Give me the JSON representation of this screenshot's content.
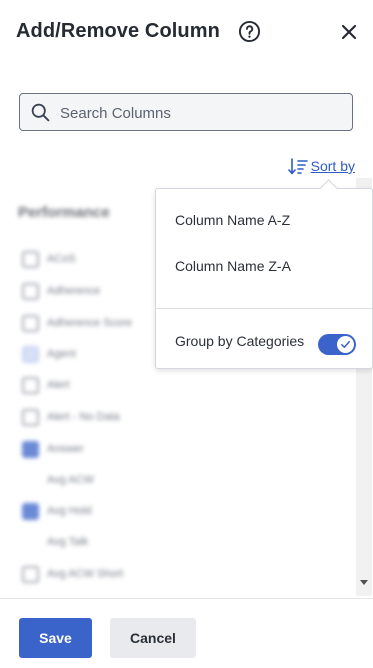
{
  "header": {
    "title": "Add/Remove Column"
  },
  "icons": {
    "help": "question-circle-icon",
    "close": "close-x-icon",
    "search": "magnifier-icon",
    "sort": "sort-descending-icon",
    "check": "check-icon"
  },
  "search": {
    "placeholder": "Search Columns",
    "value": ""
  },
  "sort": {
    "label": "Sort by"
  },
  "sort_menu": {
    "options": [
      "Column Name A-Z",
      "Column Name Z-A"
    ],
    "group_label": "Group by Categories",
    "group_enabled": true
  },
  "column_list": {
    "heading": "Performance",
    "rows": [
      {
        "label": "ACoS",
        "state": "unchecked"
      },
      {
        "label": "Adherence",
        "state": "unchecked"
      },
      {
        "label": "Adherence Score",
        "state": "unchecked"
      },
      {
        "label": "Agent",
        "state": "partial"
      },
      {
        "label": "Alert",
        "state": "unchecked"
      },
      {
        "label": "Alert - No Data",
        "state": "unchecked"
      },
      {
        "label": "Answer",
        "state": "checked"
      },
      {
        "label": "Avg ACW",
        "state": "none"
      },
      {
        "label": "Avg Hold",
        "state": "checked"
      },
      {
        "label": "Avg Talk",
        "state": "none"
      },
      {
        "label": "Avg ACW Short",
        "state": "unchecked"
      }
    ]
  },
  "footer": {
    "save_label": "Save",
    "cancel_label": "Cancel"
  },
  "colors": {
    "accent": "#3a64c9",
    "link": "#2f5bc7",
    "cancel_bg": "#e8eaee"
  }
}
